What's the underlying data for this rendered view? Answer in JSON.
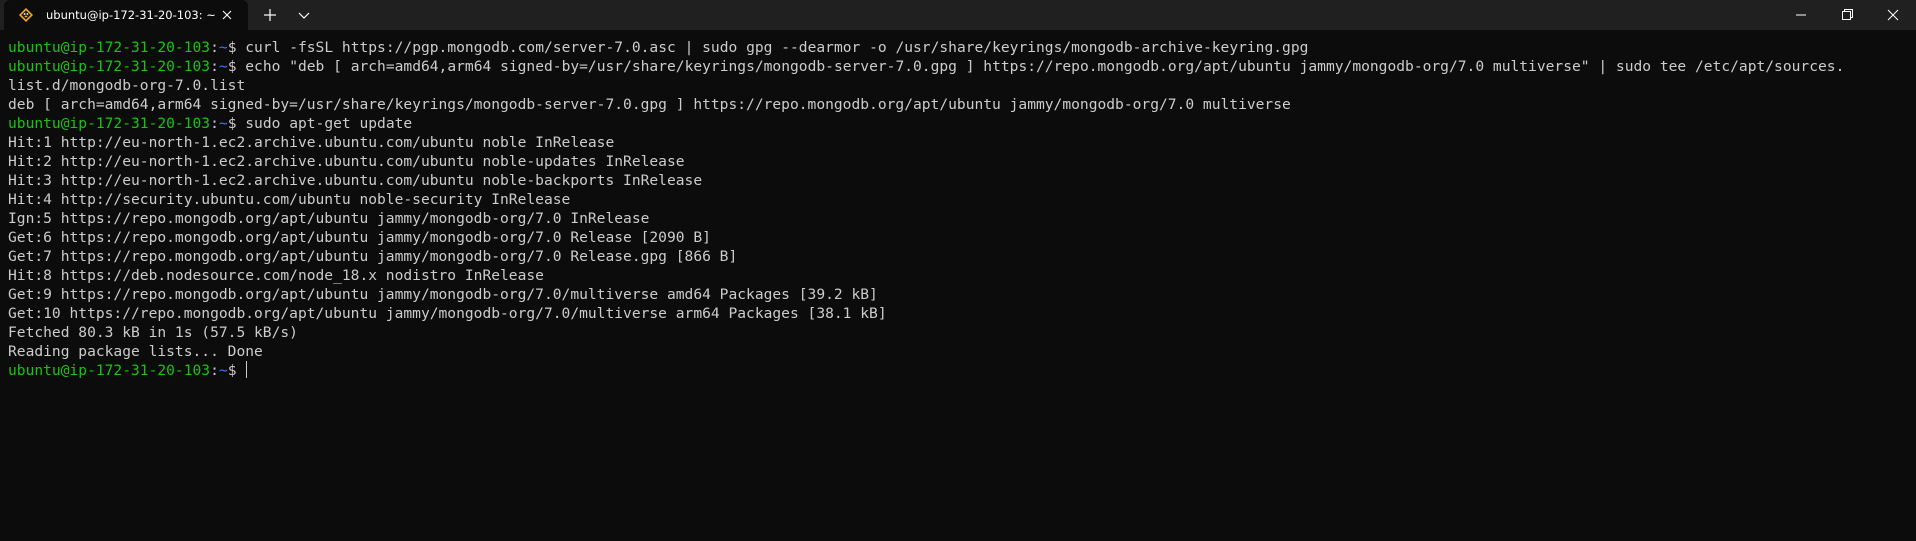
{
  "tab": {
    "title": "ubuntu@ip-172-31-20-103: ~",
    "icon": "linux-penguin-icon"
  },
  "titlebar": {
    "new_tab_icon": "plus-icon",
    "dropdown_icon": "chevron-down-icon",
    "minimize_icon": "minimize-icon",
    "maximize_icon": "restore-icon",
    "close_icon": "close-icon"
  },
  "colors": {
    "background": "#0c0c0c",
    "titlebar": "#202020",
    "prompt_user": "#16c60c",
    "prompt_path": "#3b78ff",
    "text": "#cccccc"
  },
  "terminal": {
    "lines": [
      {
        "kind": "prompt",
        "user": "ubuntu@ip-172-31-20-103",
        "sep": ":",
        "path": "~",
        "tail": "$ ",
        "text": "curl -fsSL https://pgp.mongodb.com/server-7.0.asc | sudo gpg --dearmor -o /usr/share/keyrings/mongodb-archive-keyring.gpg"
      },
      {
        "kind": "prompt",
        "user": "ubuntu@ip-172-31-20-103",
        "sep": ":",
        "path": "~",
        "tail": "$ ",
        "text": "echo \"deb [ arch=amd64,arm64 signed-by=/usr/share/keyrings/mongodb-server-7.0.gpg ] https://repo.mongodb.org/apt/ubuntu jammy/mongodb-org/7.0 multiverse\" | sudo tee /etc/apt/sources."
      },
      {
        "kind": "output",
        "text": "list.d/mongodb-org-7.0.list"
      },
      {
        "kind": "output",
        "text": "deb [ arch=amd64,arm64 signed-by=/usr/share/keyrings/mongodb-server-7.0.gpg ] https://repo.mongodb.org/apt/ubuntu jammy/mongodb-org/7.0 multiverse"
      },
      {
        "kind": "prompt",
        "user": "ubuntu@ip-172-31-20-103",
        "sep": ":",
        "path": "~",
        "tail": "$ ",
        "text": "sudo apt-get update"
      },
      {
        "kind": "output",
        "text": "Hit:1 http://eu-north-1.ec2.archive.ubuntu.com/ubuntu noble InRelease"
      },
      {
        "kind": "output",
        "text": "Hit:2 http://eu-north-1.ec2.archive.ubuntu.com/ubuntu noble-updates InRelease"
      },
      {
        "kind": "output",
        "text": "Hit:3 http://eu-north-1.ec2.archive.ubuntu.com/ubuntu noble-backports InRelease"
      },
      {
        "kind": "output",
        "text": "Hit:4 http://security.ubuntu.com/ubuntu noble-security InRelease"
      },
      {
        "kind": "output",
        "text": "Ign:5 https://repo.mongodb.org/apt/ubuntu jammy/mongodb-org/7.0 InRelease"
      },
      {
        "kind": "output",
        "text": "Get:6 https://repo.mongodb.org/apt/ubuntu jammy/mongodb-org/7.0 Release [2090 B]"
      },
      {
        "kind": "output",
        "text": "Get:7 https://repo.mongodb.org/apt/ubuntu jammy/mongodb-org/7.0 Release.gpg [866 B]"
      },
      {
        "kind": "output",
        "text": "Hit:8 https://deb.nodesource.com/node_18.x nodistro InRelease"
      },
      {
        "kind": "output",
        "text": "Get:9 https://repo.mongodb.org/apt/ubuntu jammy/mongodb-org/7.0/multiverse amd64 Packages [39.2 kB]"
      },
      {
        "kind": "output",
        "text": "Get:10 https://repo.mongodb.org/apt/ubuntu jammy/mongodb-org/7.0/multiverse arm64 Packages [38.1 kB]"
      },
      {
        "kind": "output",
        "text": "Fetched 80.3 kB in 1s (57.5 kB/s)"
      },
      {
        "kind": "output",
        "text": "Reading package lists... Done"
      },
      {
        "kind": "prompt",
        "user": "ubuntu@ip-172-31-20-103",
        "sep": ":",
        "path": "~",
        "tail": "$ ",
        "text": "",
        "cursor": true
      }
    ]
  }
}
